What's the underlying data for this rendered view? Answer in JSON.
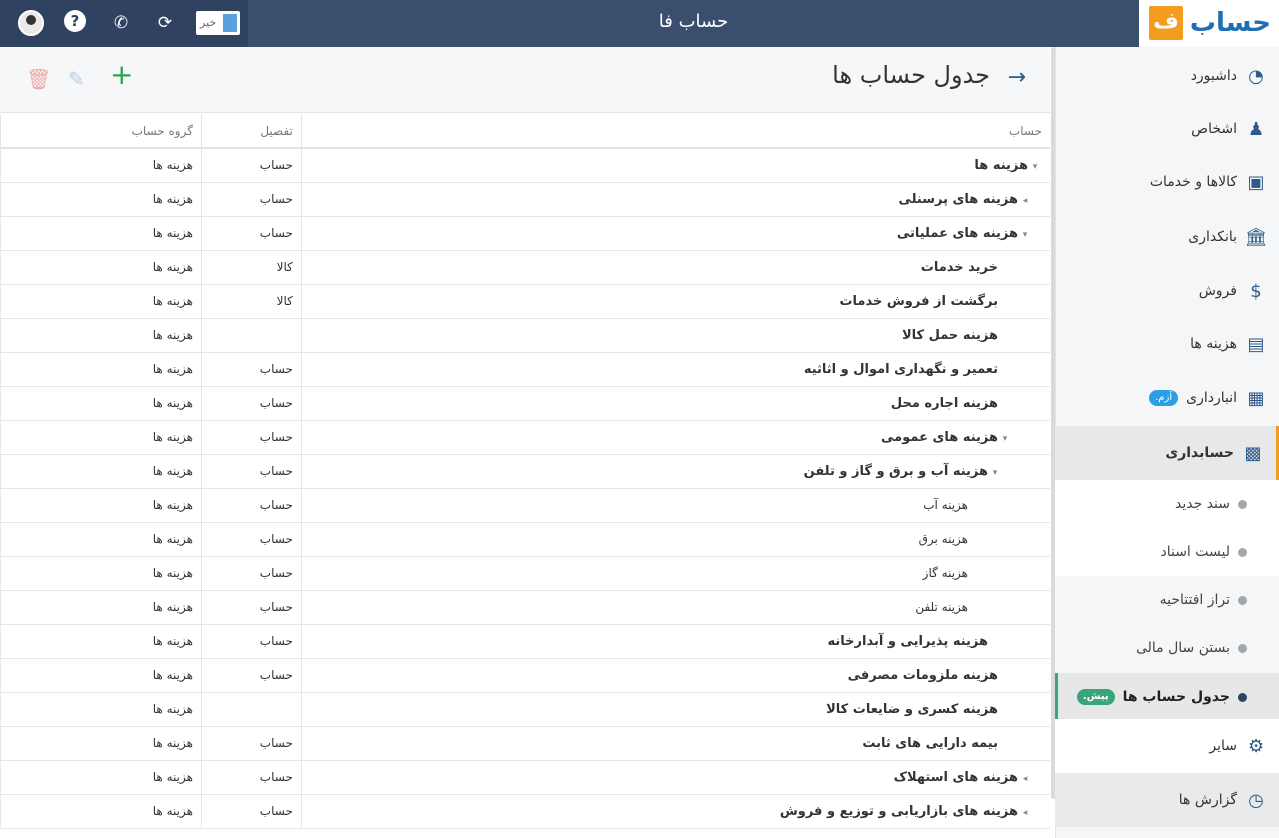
{
  "app": {
    "title": "حساب فا",
    "logo_text": "حساب",
    "logo_mark": "ف"
  },
  "toolbar": {
    "toggle_label": "خیر"
  },
  "page": {
    "title": "جدول حساب ها"
  },
  "table": {
    "headers": {
      "account": "حساب",
      "detail": "تفصیل",
      "group": "گروه حساب"
    },
    "rows": [
      {
        "name": "هزینه ها",
        "detail": "حساب",
        "group": "هزینه ها",
        "color": "black",
        "level": 0,
        "caret": "down"
      },
      {
        "name": "هزینه های پرسنلی",
        "detail": "حساب",
        "group": "هزینه ها",
        "color": "blue",
        "level": 1,
        "caret": "left"
      },
      {
        "name": "هزینه های عملیاتی",
        "detail": "حساب",
        "group": "هزینه ها",
        "color": "blue",
        "level": 1,
        "caret": "down"
      },
      {
        "name": "خرید خدمات",
        "detail": "کالا",
        "group": "هزینه ها",
        "color": "green",
        "level": 2,
        "caret": ""
      },
      {
        "name": "برگشت از فروش خدمات",
        "detail": "کالا",
        "group": "هزینه ها",
        "color": "green",
        "level": 2,
        "caret": ""
      },
      {
        "name": "هزینه حمل کالا",
        "detail": "",
        "group": "هزینه ها",
        "color": "green",
        "level": 2,
        "caret": ""
      },
      {
        "name": "تعمیر و نگهداری اموال و اثاثیه",
        "detail": "حساب",
        "group": "هزینه ها",
        "color": "green",
        "level": 2,
        "caret": ""
      },
      {
        "name": "هزینه اجاره محل",
        "detail": "حساب",
        "group": "هزینه ها",
        "color": "green",
        "level": 2,
        "caret": ""
      },
      {
        "name": "هزینه های عمومی",
        "detail": "حساب",
        "group": "هزینه ها",
        "color": "green",
        "level": 2,
        "caret": "down"
      },
      {
        "name": "هزینه آب و برق و گاز و تلفن",
        "detail": "حساب",
        "group": "هزینه ها",
        "color": "magenta",
        "level": 3,
        "caret": "down"
      },
      {
        "name": "هزینه آب",
        "detail": "حساب",
        "group": "هزینه ها",
        "color": "red",
        "level": 4,
        "caret": ""
      },
      {
        "name": "هزینه برق",
        "detail": "حساب",
        "group": "هزینه ها",
        "color": "red",
        "level": 4,
        "caret": ""
      },
      {
        "name": "هزینه گاز",
        "detail": "حساب",
        "group": "هزینه ها",
        "color": "red",
        "level": 4,
        "caret": ""
      },
      {
        "name": "هزینه تلفن",
        "detail": "حساب",
        "group": "هزینه ها",
        "color": "red",
        "level": 4,
        "caret": ""
      },
      {
        "name": "هزینه پذیرایی و آبدارخانه",
        "detail": "حساب",
        "group": "هزینه ها",
        "color": "magenta",
        "level": 3,
        "caret": ""
      },
      {
        "name": "هزینه ملزومات مصرفی",
        "detail": "حساب",
        "group": "هزینه ها",
        "color": "green",
        "level": 2,
        "caret": ""
      },
      {
        "name": "هزینه کسری و ضایعات کالا",
        "detail": "",
        "group": "هزینه ها",
        "color": "green",
        "level": 2,
        "caret": ""
      },
      {
        "name": "بیمه دارایی های ثابت",
        "detail": "حساب",
        "group": "هزینه ها",
        "color": "green",
        "level": 2,
        "caret": ""
      },
      {
        "name": "هزینه های استهلاک",
        "detail": "حساب",
        "group": "هزینه ها",
        "color": "blue",
        "level": 1,
        "caret": "left"
      },
      {
        "name": "هزینه های بازاریابی و توزیع و فروش",
        "detail": "حساب",
        "group": "هزینه ها",
        "color": "blue",
        "level": 1,
        "caret": "left"
      }
    ]
  },
  "sidebar": {
    "items": [
      {
        "label": "داشبورد",
        "icon": "dashboard-icon"
      },
      {
        "label": "اشخاص",
        "icon": "people-icon"
      },
      {
        "label": "کالاها و خدمات",
        "icon": "box-icon"
      },
      {
        "label": "بانکداری",
        "icon": "bank-icon"
      },
      {
        "label": "فروش",
        "icon": "sales-icon"
      },
      {
        "label": "هزینه ها",
        "icon": "wallet-icon"
      },
      {
        "label": "انبارداری",
        "icon": "warehouse-icon",
        "badge": "آزم."
      },
      {
        "label": "حسابداری",
        "icon": "abacus-icon"
      },
      {
        "label": "سایر",
        "icon": "other-icon"
      },
      {
        "label": "گزارش ها",
        "icon": "report-icon"
      }
    ],
    "sub_items": [
      {
        "label": "سند جدید"
      },
      {
        "label": "لیست اسناد"
      },
      {
        "label": "تراز افتتاحیه"
      },
      {
        "label": "بستن سال مالی"
      },
      {
        "label": "جدول حساب ها",
        "badge": "پیش."
      }
    ]
  }
}
